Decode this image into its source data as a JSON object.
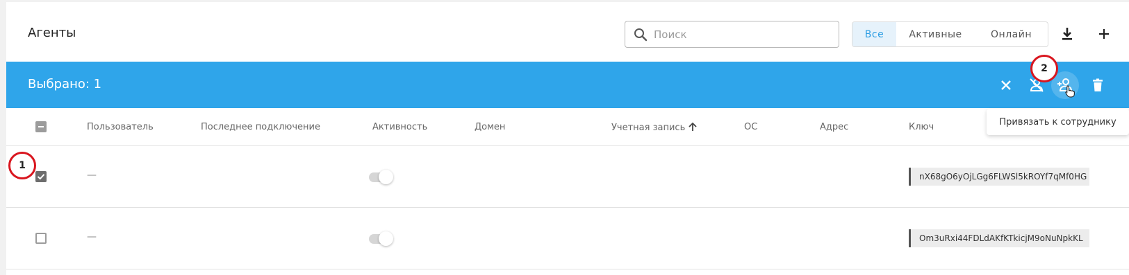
{
  "header": {
    "title": "Агенты",
    "search_placeholder": "Поиск",
    "filters": [
      {
        "label": "Все",
        "active": true
      },
      {
        "label": "Активные",
        "active": false
      },
      {
        "label": "Онлайн",
        "active": false
      }
    ],
    "download_icon": "download-icon",
    "add_icon": "plus-icon"
  },
  "selection_bar": {
    "text": "Выбрано: 1",
    "actions": [
      "close-icon",
      "unlink-user-icon",
      "link-user-icon",
      "delete-icon"
    ],
    "tooltip": "Привязать к сотруднику",
    "color": "#2fa5ea"
  },
  "table": {
    "columns": [
      "Пользователь",
      "Последнее подключение",
      "Активность",
      "Домен",
      "Учетная запись",
      "ОС",
      "Адрес",
      "Ключ"
    ],
    "sorted_column": "Учетная запись",
    "rows": [
      {
        "checked": true,
        "user": "—",
        "activity_on": false,
        "key": "nX68gO6yOjLGg6FLWSl5kROYf7qMf0HG"
      },
      {
        "checked": false,
        "user": "—",
        "activity_on": false,
        "key": "Om3uRxi44FDLdAKfKTkicjM9oNuNpkKL"
      }
    ]
  },
  "markers": [
    "1",
    "2"
  ]
}
